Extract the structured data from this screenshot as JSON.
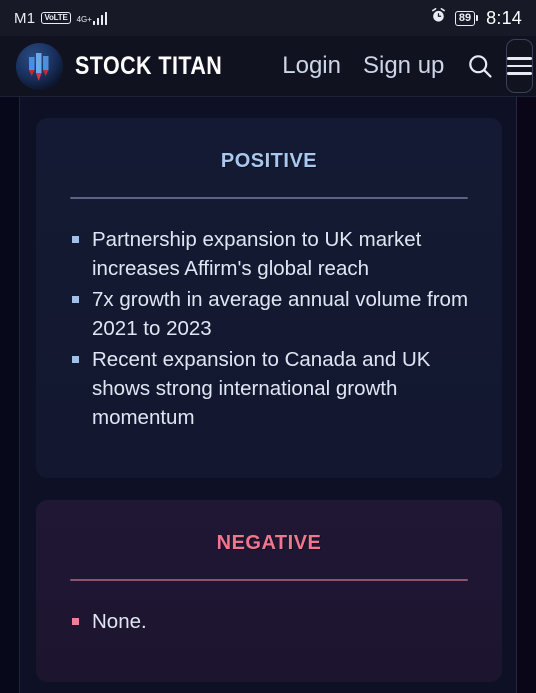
{
  "status_bar": {
    "carrier": "M1",
    "volte_badge": "VoLTE",
    "network_type": "4G+",
    "battery_percent": "89",
    "time": "8:14",
    "alarm_icon": "alarm-clock-icon"
  },
  "header": {
    "brand_name": "STOCK TITAN",
    "logo_icon": "stock-titan-logo-icon",
    "links": [
      {
        "label": "Login"
      },
      {
        "label": "Sign up"
      }
    ],
    "search_icon": "search-icon",
    "menu_icon": "hamburger-menu-icon"
  },
  "main": {
    "cards": [
      {
        "title": "Positive",
        "accent": "#a8c8f0",
        "bullets": [
          "Partnership expansion to UK market increases Affirm's global reach",
          "7x growth in average annual volume from 2021 to 2023",
          "Recent expansion to Canada and UK shows strong international growth momentum"
        ]
      },
      {
        "title": "Negative",
        "accent": "#f2758f",
        "bullets": [
          "None."
        ]
      }
    ]
  }
}
